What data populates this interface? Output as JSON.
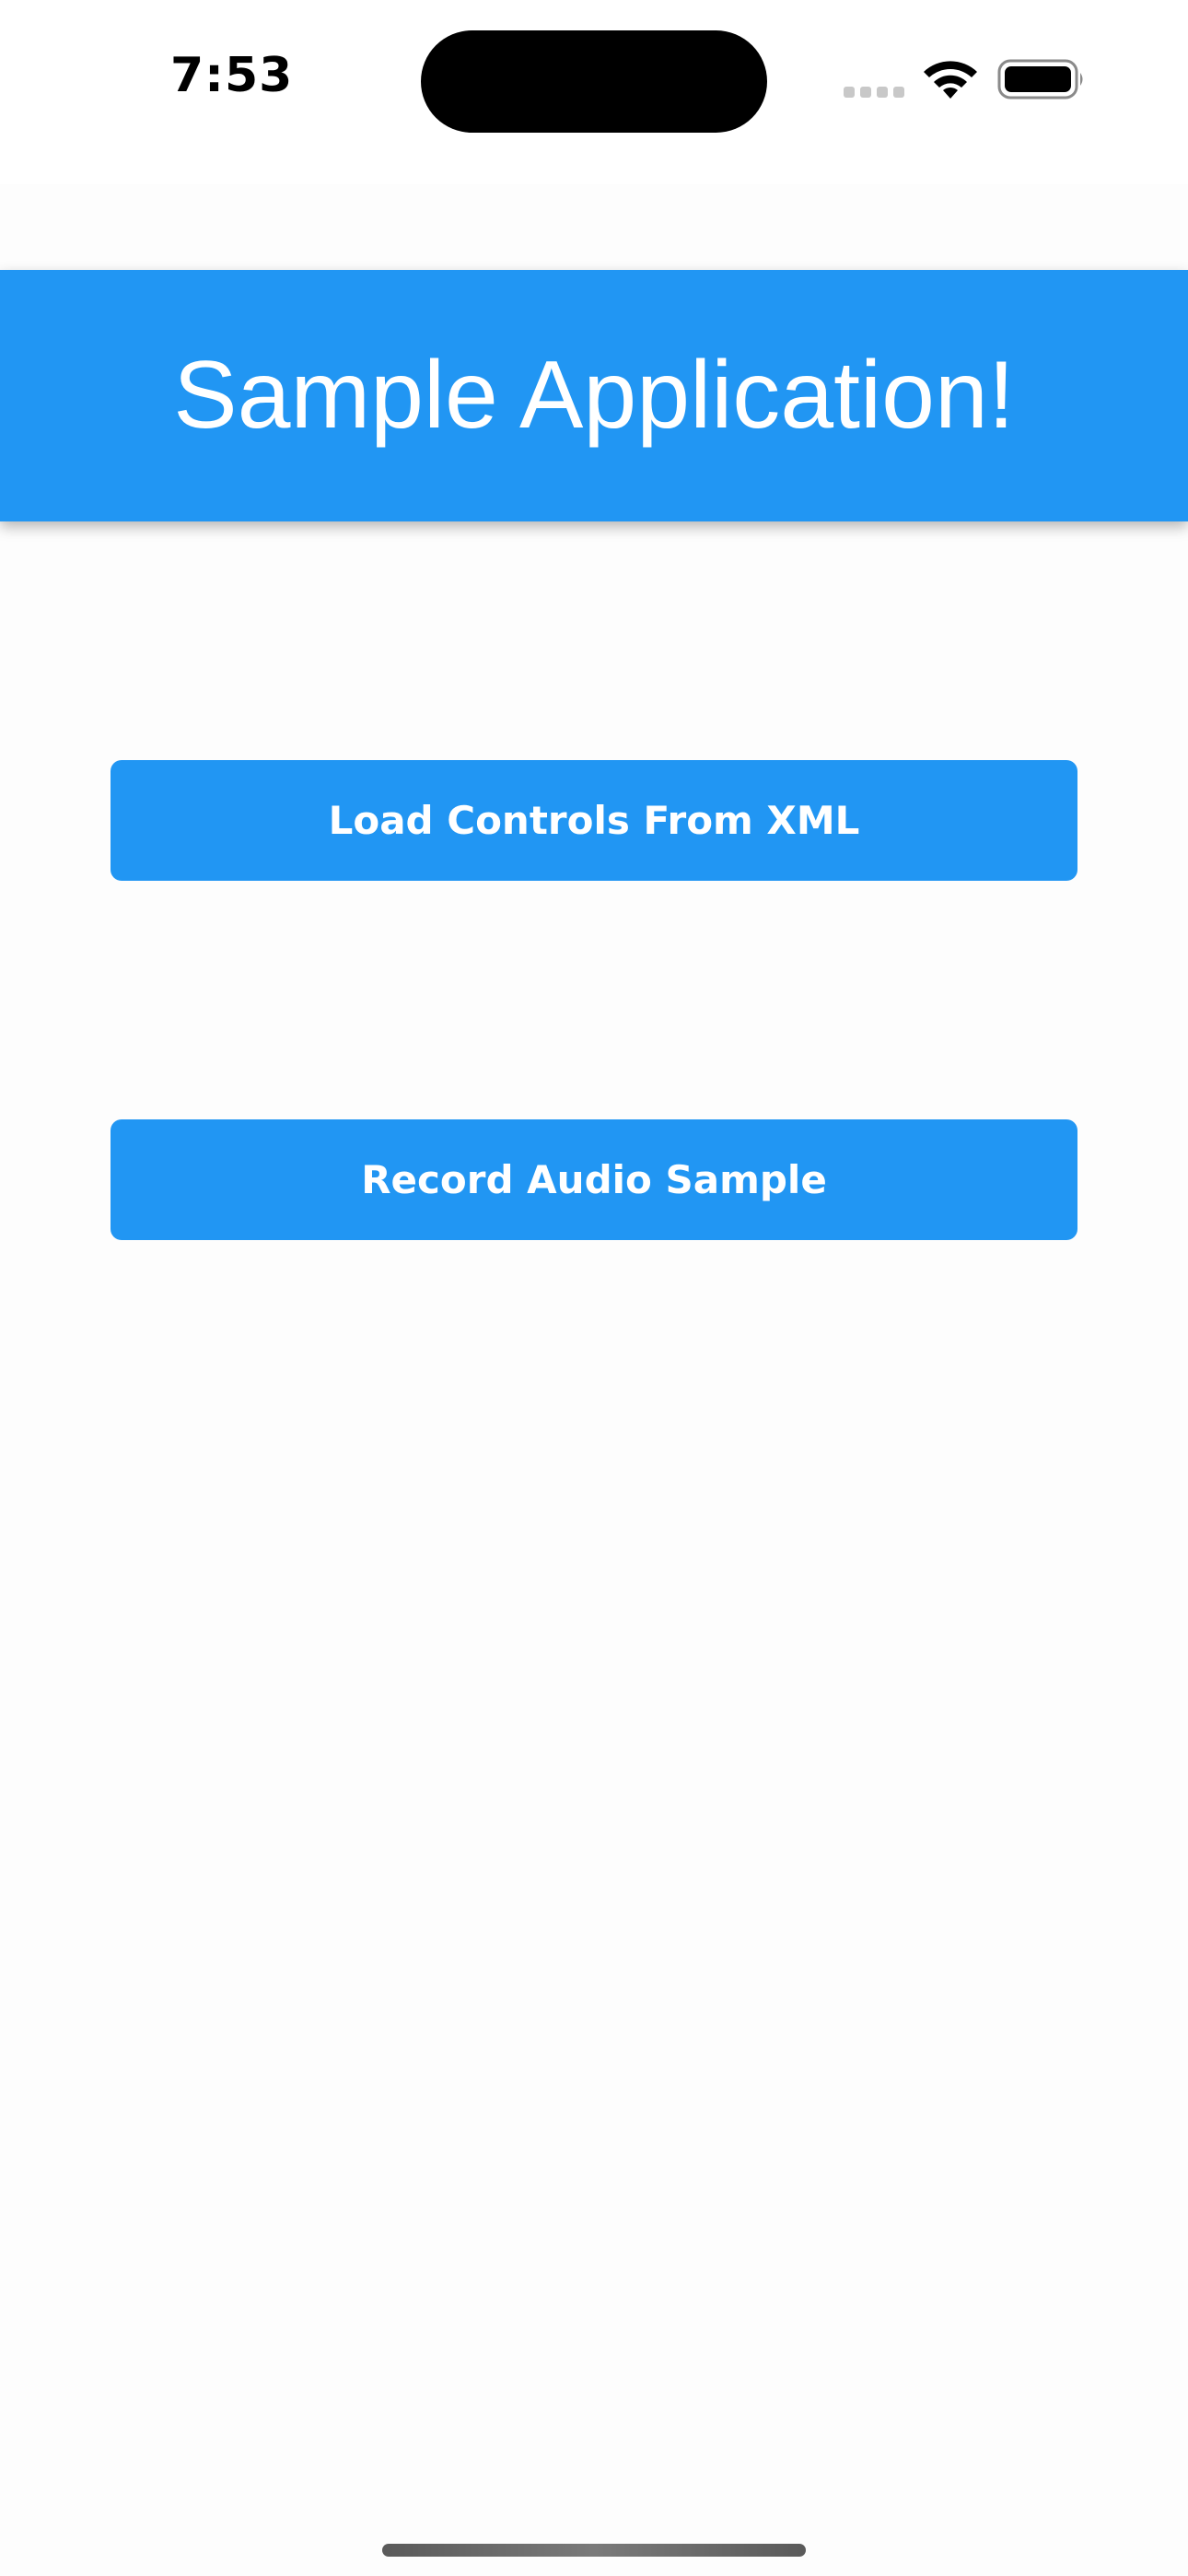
{
  "status_bar": {
    "time": "7:53",
    "icons": [
      "signal-icon",
      "wifi-icon",
      "battery-icon"
    ]
  },
  "header": {
    "title": "Sample Application!"
  },
  "buttons": {
    "load_controls_label": "Load Controls From XML",
    "record_audio_label": "Record Audio Sample"
  },
  "colors": {
    "primary": "#2196f3",
    "background": "#fdfdfd",
    "text_on_primary": "#ffffff"
  }
}
